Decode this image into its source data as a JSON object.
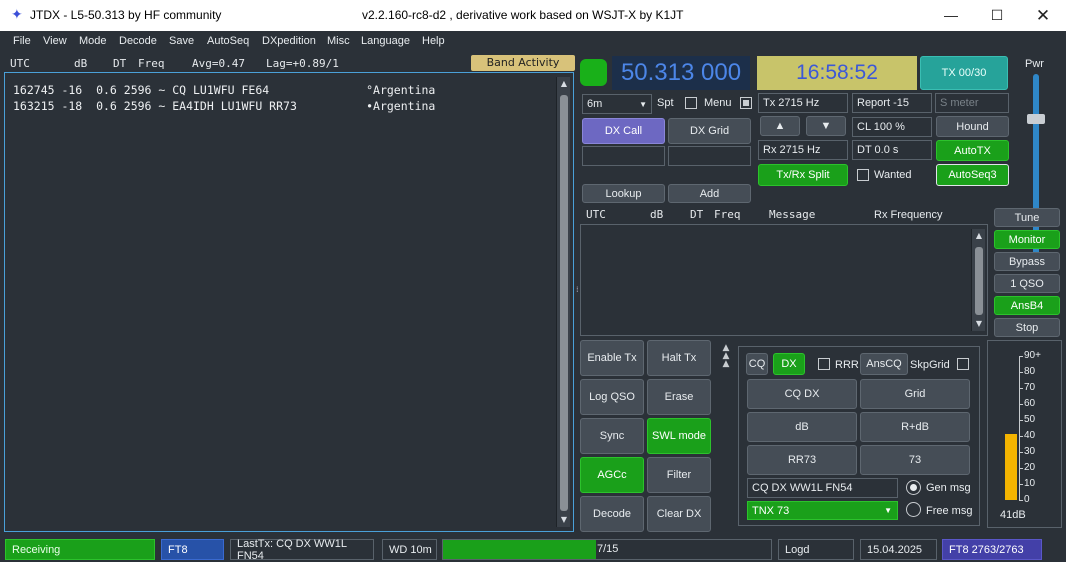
{
  "window": {
    "title_left": "JTDX - L5-50.313  by HF community",
    "title_right": "v2.2.160-rc8-d2 , derivative work based on WSJT-X by K1JT",
    "logo_icon": "star-icon"
  },
  "menu": [
    "File",
    "View",
    "Mode",
    "Decode",
    "Save",
    "AutoSeq",
    "DXpedition",
    "Misc",
    "Language",
    "Help"
  ],
  "band_header": {
    "utc": "UTC",
    "db": "dB",
    "dt": "DT",
    "freq": "Freq",
    "avg": "Avg=0.47",
    "lag": "Lag=+0.89/1"
  },
  "band_activity_label": "Band Activity",
  "band_lines": [
    "162745 -16  0.6 2596 ~ CQ LU1WFU FE64              °Argentina",
    "163215 -18  0.6 2596 ~ EA4IDH LU1WFU RR73          •Argentina"
  ],
  "frequency": "50.313 000",
  "clock": "16:58:52",
  "tx_counter": "TX 00/30",
  "pwr_label": "Pwr",
  "band_select": "6m",
  "spt_label": "Spt",
  "menu_label": "Menu",
  "tx_freq": "Tx  2715 Hz",
  "rx_freq": "Rx  2715 Hz",
  "report": "Report -15",
  "smeter_placeholder": "S meter",
  "cl": "CL  100 %",
  "dt": "DT 0.0 s",
  "buttons": {
    "dx_call": "DX Call",
    "dx_grid": "DX Grid",
    "lookup": "Lookup",
    "add": "Add",
    "hound": "Hound",
    "autotx": "AutoTX",
    "txrx_split": "Tx/Rx Split",
    "wanted": "Wanted",
    "autoseq3": "AutoSeq3",
    "tune": "Tune",
    "monitor": "Monitor",
    "bypass": "Bypass",
    "one_qso": "1 QSO",
    "ansb4": "AnsB4",
    "stop": "Stop",
    "enable_tx": "Enable Tx",
    "halt_tx": "Halt Tx",
    "log_qso": "Log QSO",
    "erase": "Erase",
    "sync": "Sync",
    "swl_mode": "SWL mode",
    "agcc": "AGCc",
    "filter": "Filter",
    "decode": "Decode",
    "clear_dx": "Clear DX"
  },
  "rx_header": {
    "utc": "UTC",
    "db": "dB",
    "dt": "DT",
    "freq": "Freq",
    "message": "Message",
    "rx_frequency": "Rx Frequency"
  },
  "macros": {
    "cq": "CQ",
    "dx": "DX",
    "rrr": "RRR",
    "anscq": "AnsCQ",
    "skpgrid": "SkpGrid",
    "cq_dx": "CQ DX",
    "grid": "Grid",
    "db": "dB",
    "r_db": "R+dB",
    "rr73": "RR73",
    "seventy_three": "73",
    "gen_field": "CQ DX WW1L FN54",
    "gen_msg": "Gen msg",
    "free_select": "TNX 73",
    "free_msg": "Free msg"
  },
  "meter": {
    "ticks": [
      "90+",
      "80",
      "70",
      "60",
      "50",
      "40",
      "30",
      "20",
      "10",
      "0"
    ],
    "level_db": "41dB",
    "level_value": 41,
    "max": 90
  },
  "status": {
    "state": "Receiving",
    "mode": "FT8",
    "last_tx": "LastTx: CQ DX WW1L FN54",
    "wd": "WD 10m",
    "progress_text": "7/15",
    "progress_value": 7,
    "progress_max": 15,
    "logd": "Logd",
    "date": "15.04.2025",
    "mode_count": "FT8  2763/2763"
  },
  "colors": {
    "accent_green": "#1aa01a",
    "purple": "#6d68c2",
    "teal": "#26a39a",
    "clock_bg": "#c8c46a",
    "freq_fg": "#4c86e8",
    "meter_bar": "#f4b400"
  }
}
